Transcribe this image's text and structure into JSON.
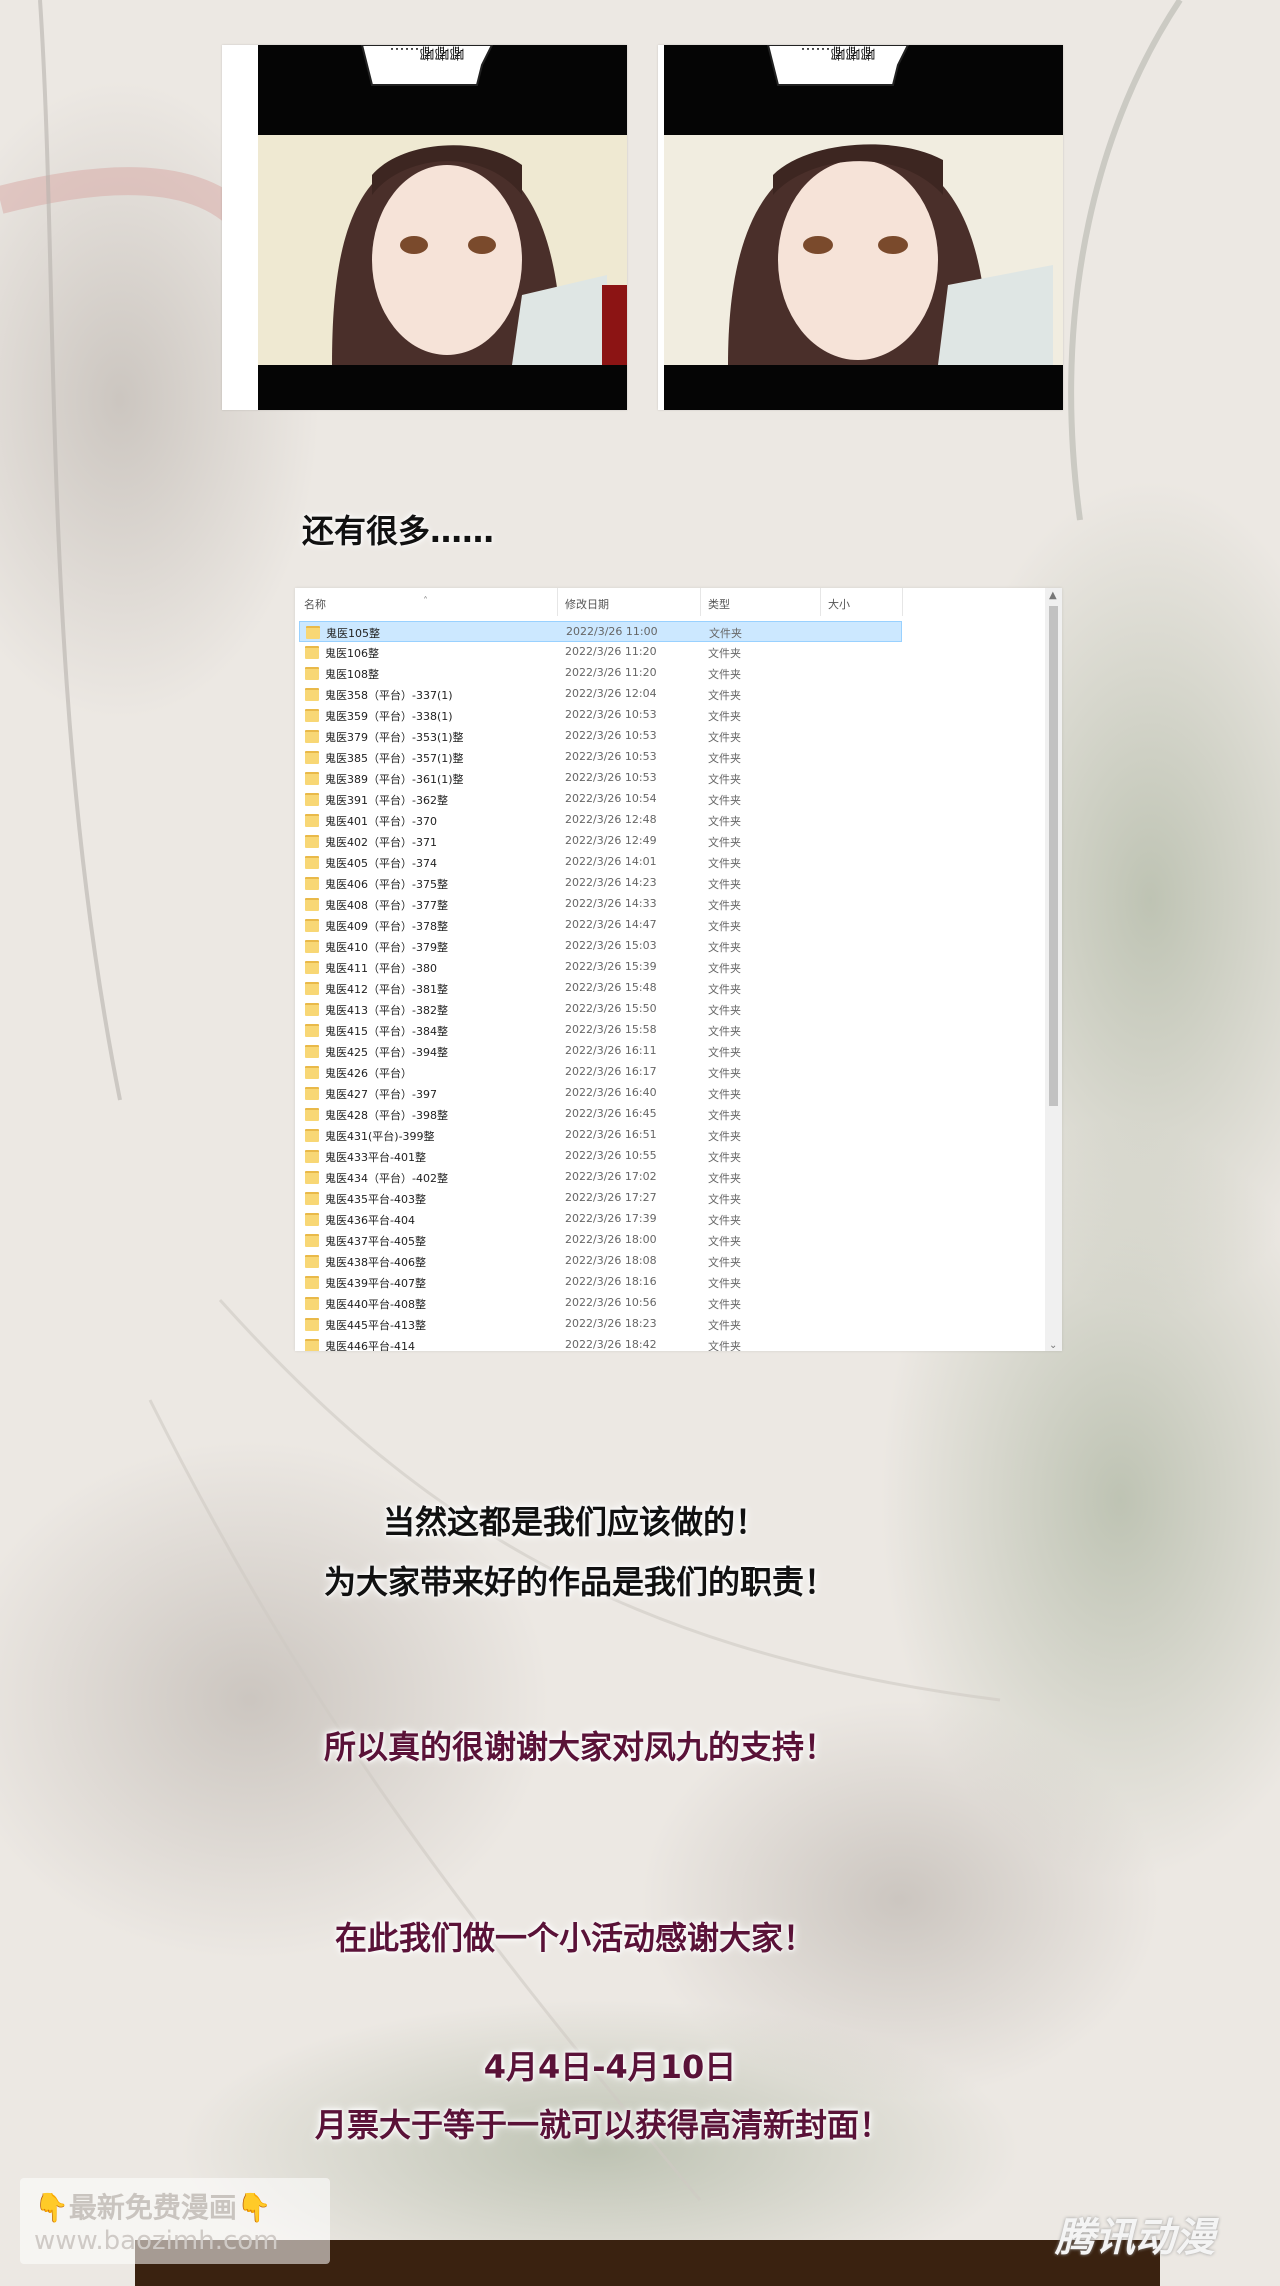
{
  "panels": [
    {
      "bubble_text": "嘟嘟嘟……"
    },
    {
      "bubble_text": "嘟嘟嘟……"
    }
  ],
  "heading": "还有很多……",
  "explorer": {
    "columns": {
      "name": "名称",
      "date": "修改日期",
      "type": "类型",
      "size": "大小"
    },
    "rows": [
      {
        "name": "鬼医105整",
        "date": "2022/3/26 11:00",
        "type": "文件夹"
      },
      {
        "name": "鬼医106整",
        "date": "2022/3/26 11:20",
        "type": "文件夹"
      },
      {
        "name": "鬼医108整",
        "date": "2022/3/26 11:20",
        "type": "文件夹"
      },
      {
        "name": "鬼医358（平台）-337(1)",
        "date": "2022/3/26 12:04",
        "type": "文件夹"
      },
      {
        "name": "鬼医359（平台）-338(1)",
        "date": "2022/3/26 10:53",
        "type": "文件夹"
      },
      {
        "name": "鬼医379（平台）-353(1)整",
        "date": "2022/3/26 10:53",
        "type": "文件夹"
      },
      {
        "name": "鬼医385（平台）-357(1)整",
        "date": "2022/3/26 10:53",
        "type": "文件夹"
      },
      {
        "name": "鬼医389（平台）-361(1)整",
        "date": "2022/3/26 10:53",
        "type": "文件夹"
      },
      {
        "name": "鬼医391（平台）-362整",
        "date": "2022/3/26 10:54",
        "type": "文件夹"
      },
      {
        "name": "鬼医401（平台）-370",
        "date": "2022/3/26 12:48",
        "type": "文件夹"
      },
      {
        "name": "鬼医402（平台）-371",
        "date": "2022/3/26 12:49",
        "type": "文件夹"
      },
      {
        "name": "鬼医405（平台）-374",
        "date": "2022/3/26 14:01",
        "type": "文件夹"
      },
      {
        "name": "鬼医406（平台）-375整",
        "date": "2022/3/26 14:23",
        "type": "文件夹"
      },
      {
        "name": "鬼医408（平台）-377整",
        "date": "2022/3/26 14:33",
        "type": "文件夹"
      },
      {
        "name": "鬼医409（平台）-378整",
        "date": "2022/3/26 14:47",
        "type": "文件夹"
      },
      {
        "name": "鬼医410（平台）-379整",
        "date": "2022/3/26 15:03",
        "type": "文件夹"
      },
      {
        "name": "鬼医411（平台）-380",
        "date": "2022/3/26 15:39",
        "type": "文件夹"
      },
      {
        "name": "鬼医412（平台）-381整",
        "date": "2022/3/26 15:48",
        "type": "文件夹"
      },
      {
        "name": "鬼医413（平台）-382整",
        "date": "2022/3/26 15:50",
        "type": "文件夹"
      },
      {
        "name": "鬼医415（平台）-384整",
        "date": "2022/3/26 15:58",
        "type": "文件夹"
      },
      {
        "name": "鬼医425（平台）-394整",
        "date": "2022/3/26 16:11",
        "type": "文件夹"
      },
      {
        "name": "鬼医426（平台）",
        "date": "2022/3/26 16:17",
        "type": "文件夹"
      },
      {
        "name": "鬼医427（平台）-397",
        "date": "2022/3/26 16:40",
        "type": "文件夹"
      },
      {
        "name": "鬼医428（平台）-398整",
        "date": "2022/3/26 16:45",
        "type": "文件夹"
      },
      {
        "name": "鬼医431(平台)-399整",
        "date": "2022/3/26 16:51",
        "type": "文件夹"
      },
      {
        "name": "鬼医433平台-401整",
        "date": "2022/3/26 10:55",
        "type": "文件夹"
      },
      {
        "name": "鬼医434（平台）-402整",
        "date": "2022/3/26 17:02",
        "type": "文件夹"
      },
      {
        "name": "鬼医435平台-403整",
        "date": "2022/3/26 17:27",
        "type": "文件夹"
      },
      {
        "name": "鬼医436平台-404",
        "date": "2022/3/26 17:39",
        "type": "文件夹"
      },
      {
        "name": "鬼医437平台-405整",
        "date": "2022/3/26 18:00",
        "type": "文件夹"
      },
      {
        "name": "鬼医438平台-406整",
        "date": "2022/3/26 18:08",
        "type": "文件夹"
      },
      {
        "name": "鬼医439平台-407整",
        "date": "2022/3/26 18:16",
        "type": "文件夹"
      },
      {
        "name": "鬼医440平台-408整",
        "date": "2022/3/26 10:56",
        "type": "文件夹"
      },
      {
        "name": "鬼医445平台-413整",
        "date": "2022/3/26 18:23",
        "type": "文件夹"
      },
      {
        "name": "鬼医446平台-414",
        "date": "2022/3/26 18:42",
        "type": "文件夹"
      }
    ]
  },
  "messages": {
    "line1": "当然这都是我们应该做的！",
    "line2": "为大家带来好的作品是我们的职责！",
    "line3": "所以真的很谢谢大家对凤九的支持！",
    "line4": "在此我们做一个小活动感谢大家！",
    "line5": "4月4日-4月10日",
    "line6": "月票大于等于一就可以获得高清新封面！"
  },
  "watermark": {
    "line1": "👇最新免费漫画👇",
    "line2": "www.baozimh.com"
  },
  "brand_logo": "腾讯动漫",
  "colors": {
    "message_purple": "#5a1238",
    "selection": "#cce8ff",
    "folder": "#f8d775"
  }
}
